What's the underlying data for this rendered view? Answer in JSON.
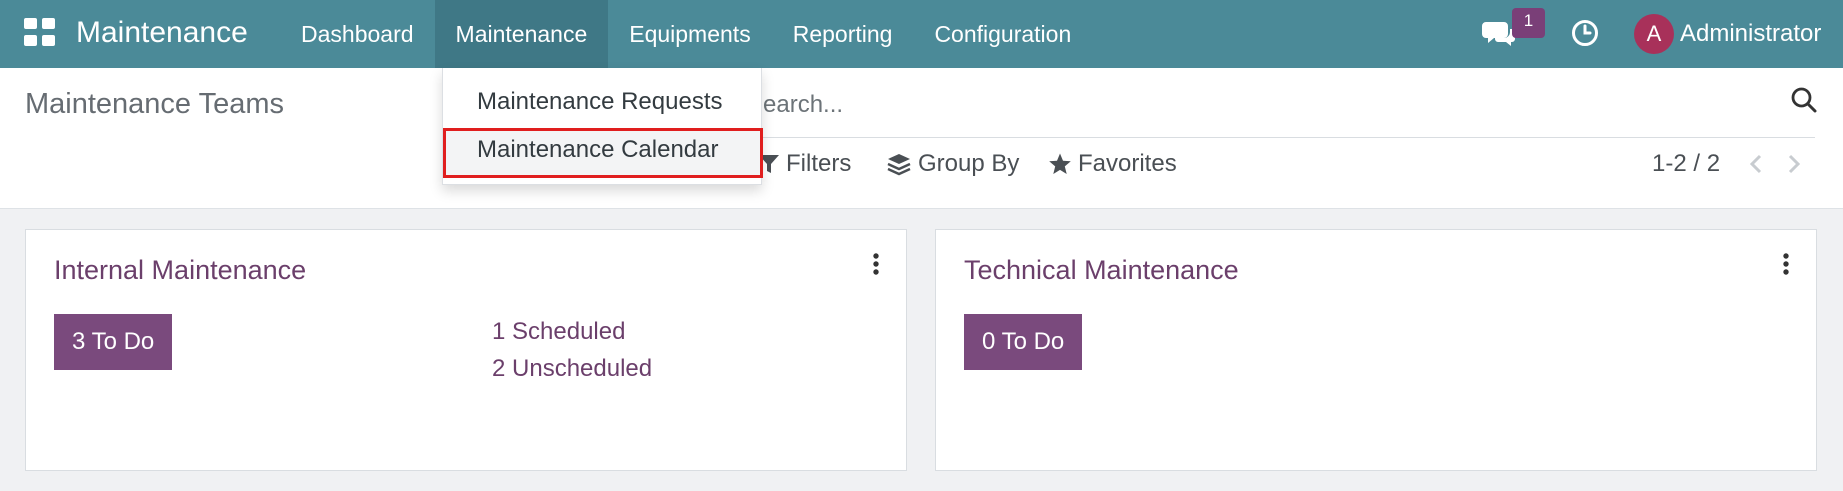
{
  "navbar": {
    "brand": "Maintenance",
    "menu": [
      "Dashboard",
      "Maintenance",
      "Equipments",
      "Reporting",
      "Configuration"
    ],
    "active_menu": "Maintenance",
    "chat_badge": "1",
    "avatar_initial": "A",
    "user_name": "Administrator",
    "color": "#4b8a98"
  },
  "dropdown": {
    "items": [
      "Maintenance Requests",
      "Maintenance Calendar"
    ],
    "highlighted": "Maintenance Calendar"
  },
  "control_panel": {
    "title": "Maintenance Teams",
    "search_placeholder": "Search...",
    "filters_label": "Filters",
    "groupby_label": "Group By",
    "favorites_label": "Favorites",
    "pager": "1-2 / 2"
  },
  "cards": [
    {
      "title": "Internal Maintenance",
      "todo": "3 To Do",
      "scheduled": "1 Scheduled",
      "unscheduled": "2 Unscheduled"
    },
    {
      "title": "Technical Maintenance",
      "todo": "0 To Do"
    }
  ],
  "colors": {
    "accent": "#7a4a7d",
    "card_title": "#6b3f6b",
    "highlight_border": "#e01e1e"
  }
}
